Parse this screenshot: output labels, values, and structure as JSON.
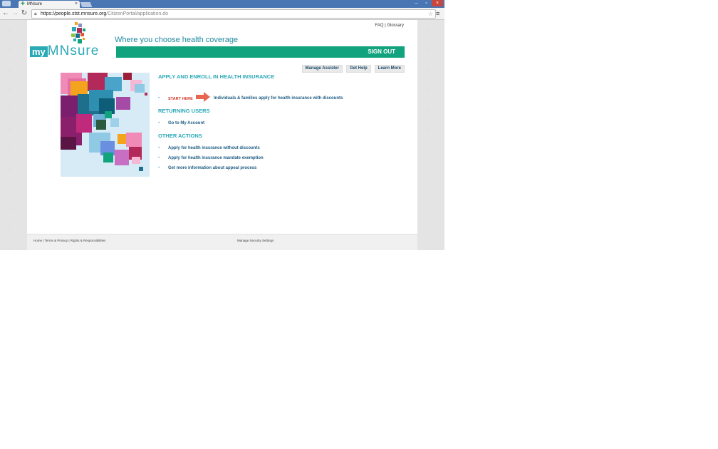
{
  "browser": {
    "tab_title": "MNsure",
    "url_host": "https://people.stst.mnsure.org",
    "url_path": "/CitizenPortal/application.do"
  },
  "header": {
    "logo_my": "my",
    "logo_mnsure": "MNsure",
    "tagline": "Where you choose health coverage",
    "faq": "FAQ",
    "separator": "|",
    "glossary": "Glossary",
    "sign_out": "SIGN OUT",
    "nav": [
      "Manage Assister",
      "Get Help",
      "Learn More"
    ]
  },
  "sections": {
    "apply": {
      "heading": "APPLY AND ENROLL IN HEALTH INSURANCE",
      "start_here": "START HERE",
      "item": "Individuals & families apply for health insurance with discounts"
    },
    "returning": {
      "heading": "RETURNING USERS",
      "item": "Go to My Account"
    },
    "other": {
      "heading": "OTHER ACTIONS",
      "items": [
        "Apply for health insurance without discounts",
        "Apply for health insurance mandate exemption",
        "Get more information about appeal process"
      ]
    }
  },
  "footer": {
    "links": [
      "Home",
      "Terms & Privacy",
      "Rights & Responsibilities"
    ],
    "separator": " | ",
    "security": "Manage Security Settings"
  },
  "colors": {
    "brand_teal": "#2aa9b6",
    "brand_green": "#10a37e",
    "link_blue": "#1d5c83",
    "start_red": "#d0392b"
  },
  "icons": [
    "back-icon",
    "forward-icon",
    "reload-icon",
    "lock-icon",
    "star-icon",
    "menu-icon",
    "arrow-right-icon",
    "close-icon"
  ]
}
